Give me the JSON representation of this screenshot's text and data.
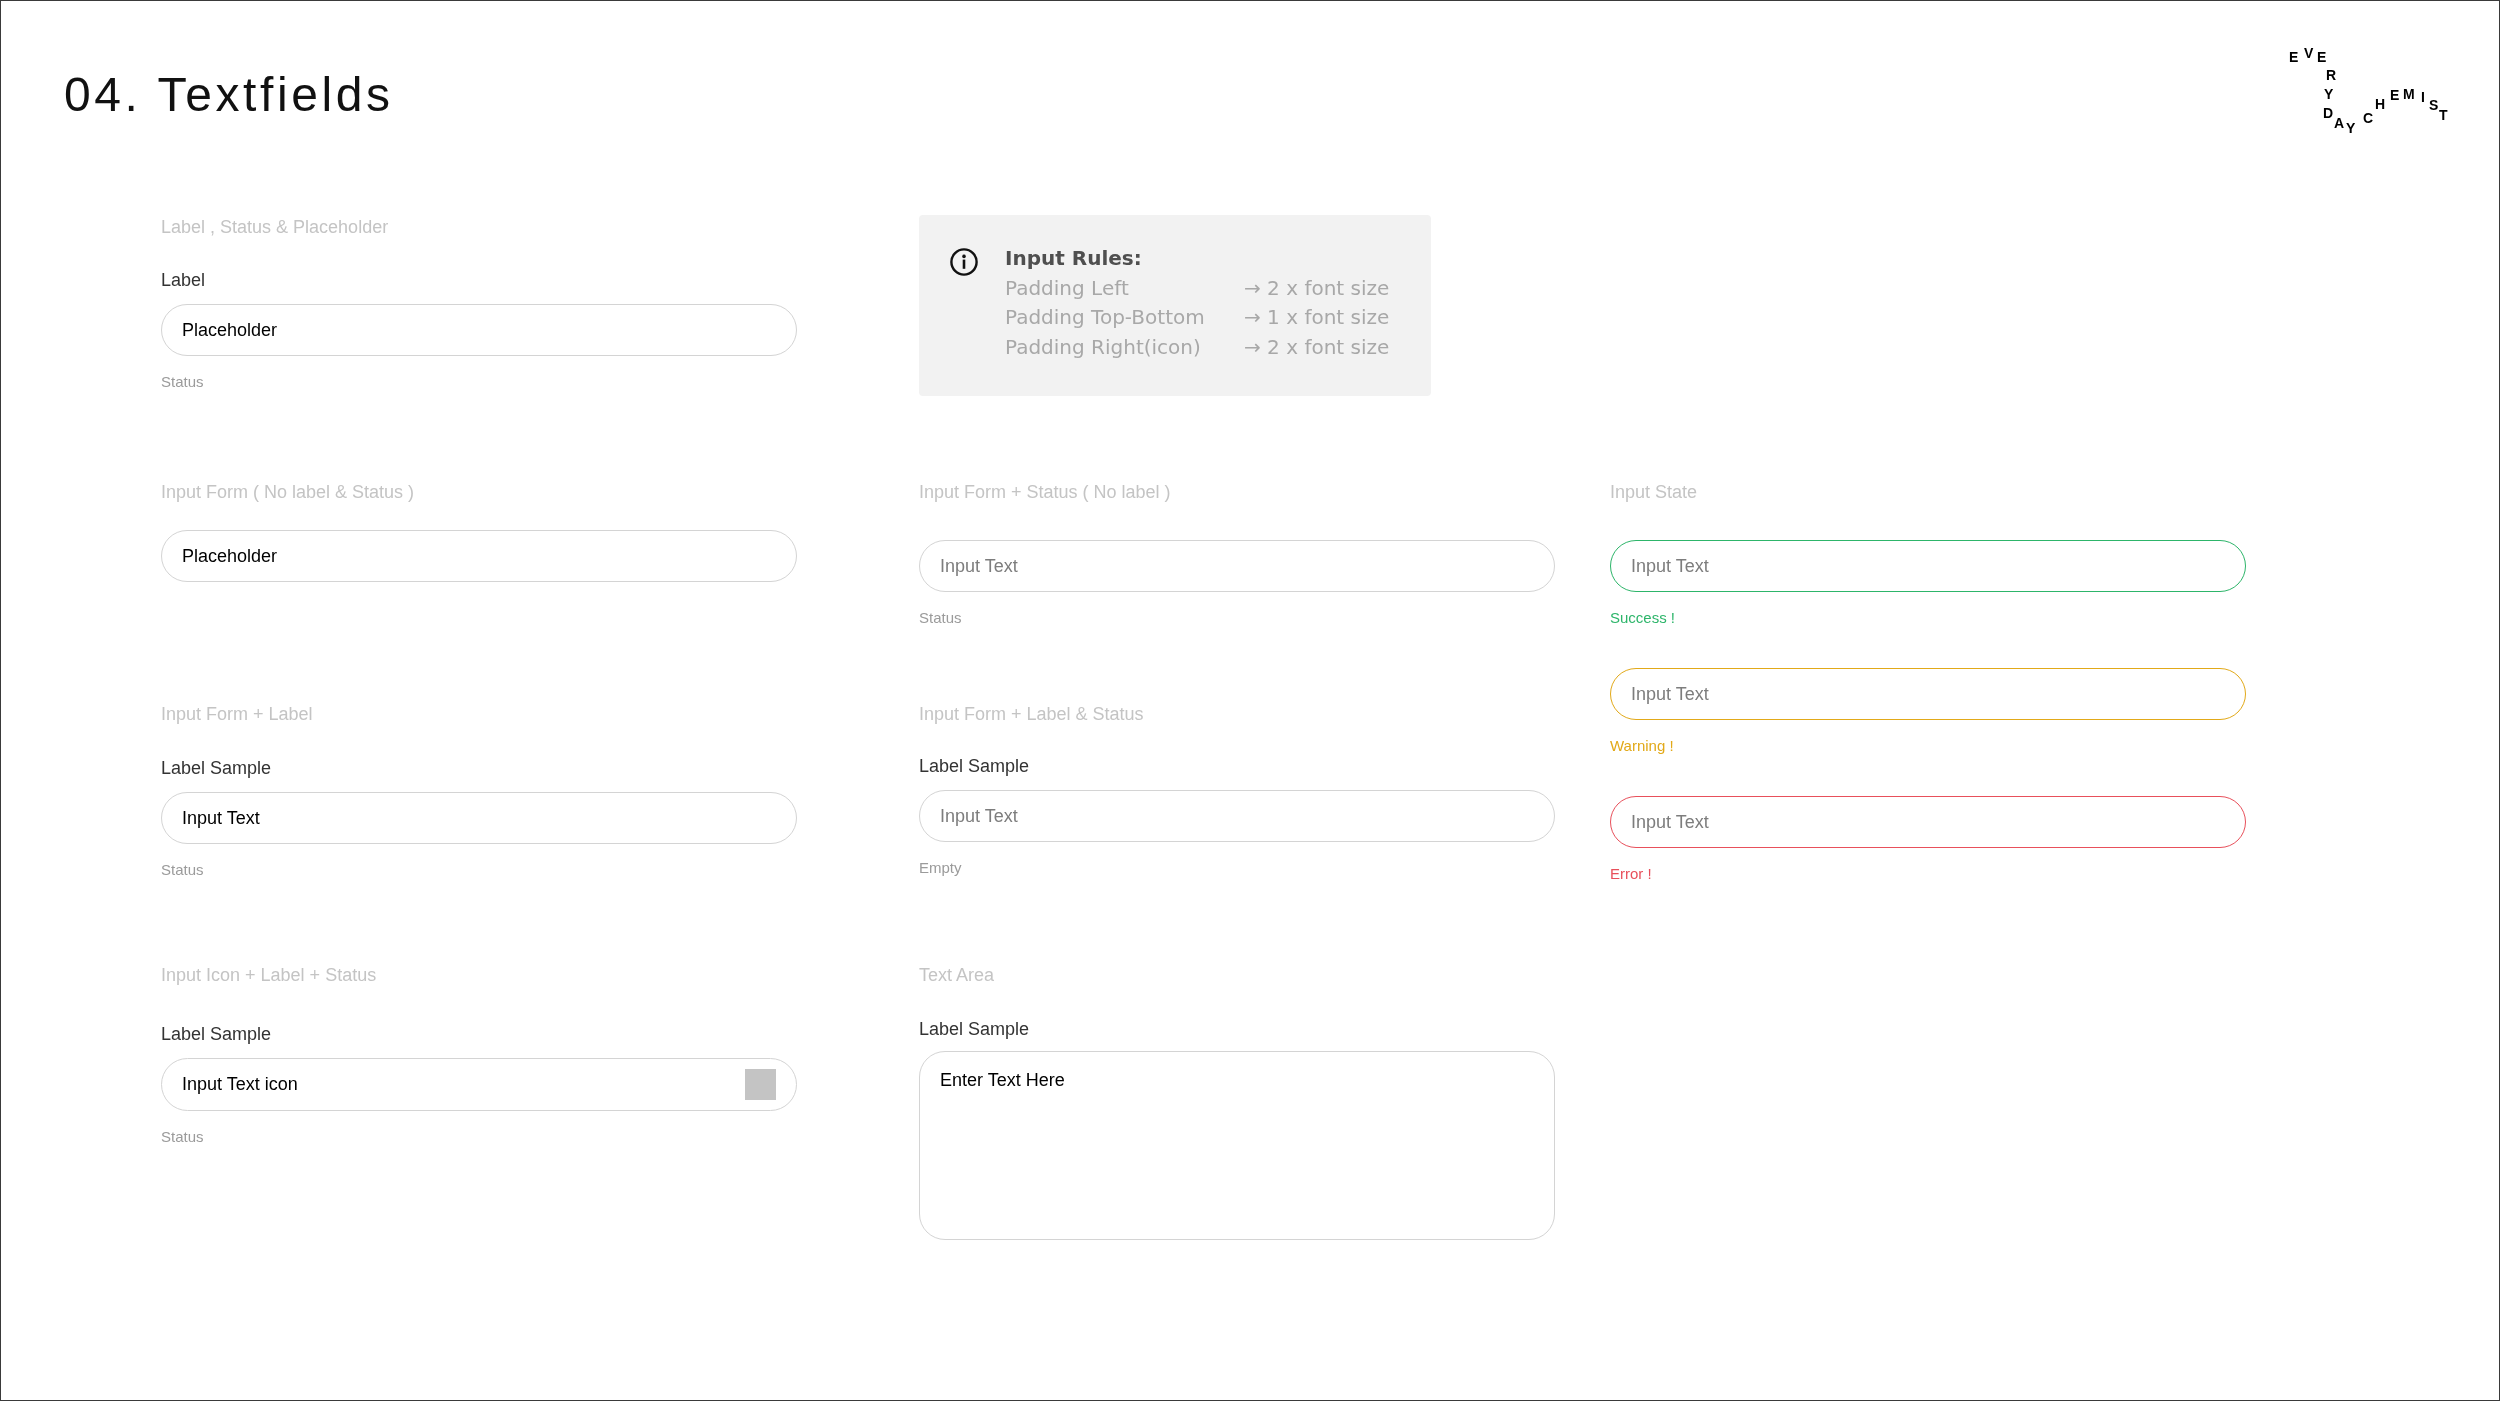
{
  "title": "04. Textfields",
  "logo": {
    "letters": [
      "E",
      "V",
      "E",
      "R",
      "Y",
      "D",
      "A",
      "Y",
      "C",
      "H",
      "E",
      "M",
      "I",
      "S",
      "T"
    ]
  },
  "columns": [
    {
      "panels": [
        {
          "kind": "section",
          "heading": "Label , Status & Placeholder",
          "fields": [
            {
              "kind": "input",
              "label": "Label",
              "value": "Placeholder",
              "status": "Status"
            }
          ]
        },
        {
          "kind": "section",
          "heading": "Input Form ( No label & Status )",
          "fields": [
            {
              "kind": "input",
              "value": "Placeholder"
            }
          ]
        },
        {
          "kind": "section",
          "heading": "Input Form + Label",
          "fields": [
            {
              "kind": "input",
              "label": "Label Sample",
              "value": "Input Text",
              "status": "Status"
            }
          ]
        },
        {
          "kind": "section",
          "heading": "Input Icon + Label + Status",
          "fields": [
            {
              "kind": "icon",
              "label": "Label Sample",
              "value": "Input Text icon",
              "status": "Status"
            }
          ]
        }
      ]
    },
    {
      "panels": [
        {
          "kind": "info",
          "title": "Input Rules:",
          "rules": [
            {
              "name": "Padding Left",
              "value": "→ 2 x font size"
            },
            {
              "name": "Padding Top-Bottom",
              "value": "→ 1 x font size"
            },
            {
              "name": "Padding Right(icon)",
              "value": "→ 2 x font size"
            }
          ]
        },
        {
          "kind": "section",
          "heading": "Input Form + Status ( No label )",
          "fields": [
            {
              "kind": "input",
              "placeholder": "Input Text",
              "status": "Status"
            }
          ]
        },
        {
          "kind": "section",
          "heading": "Input Form + Label & Status",
          "fields": [
            {
              "kind": "input",
              "label": "Label Sample",
              "placeholder": "Input Text",
              "status": "Empty"
            }
          ]
        },
        {
          "kind": "section",
          "heading": "Text Area",
          "fields": [
            {
              "kind": "textarea",
              "label": "Label Sample",
              "value": "Enter Text Here"
            }
          ]
        }
      ]
    },
    {
      "panels": [
        {
          "kind": "section",
          "heading": "Input State",
          "fields": [
            {
              "kind": "input",
              "color": "#2db56a",
              "placeholder": "Input Text",
              "status": "Success !"
            },
            {
              "kind": "input",
              "color": "#e2a919",
              "placeholder": "Input Text",
              "status": "Warning !"
            },
            {
              "kind": "input",
              "color": "#e8505b",
              "placeholder": "Input Text",
              "status": "Error !"
            }
          ]
        }
      ]
    }
  ]
}
